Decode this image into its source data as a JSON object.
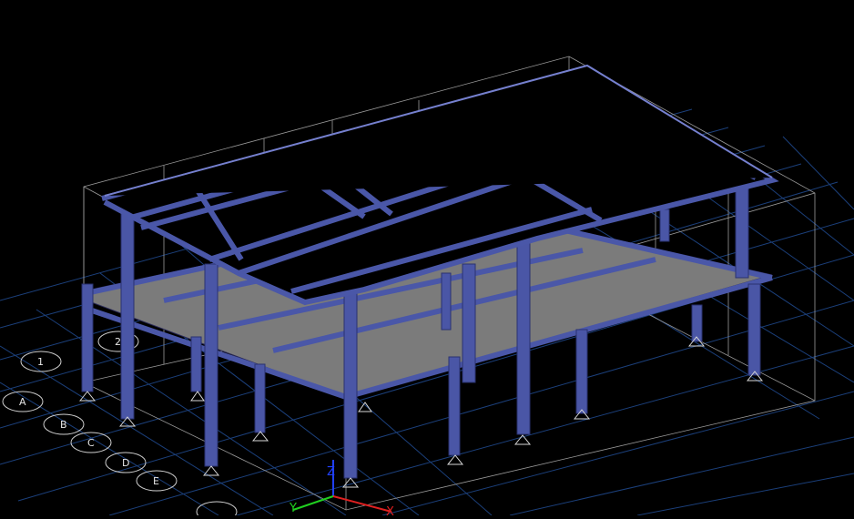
{
  "viewport": {
    "background": "#000000",
    "grid_color": "#1b3f7a",
    "structure_color": "#4a57a8",
    "slab_color": "#7b7b7b"
  },
  "grid_labels": [
    "1",
    "2",
    "A",
    "B",
    "C",
    "D",
    "E"
  ],
  "axes": {
    "x_label": "X",
    "y_label": "Y",
    "z_label": "Z",
    "x_color": "#e02020",
    "y_color": "#20d020",
    "z_color": "#2040ff"
  }
}
